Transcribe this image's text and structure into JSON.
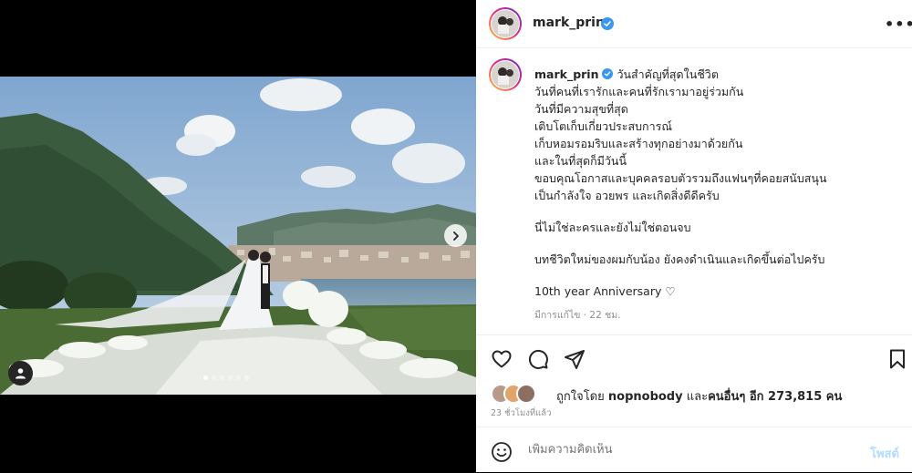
{
  "post": {
    "username": "mark_prin",
    "caption_lines": [
      "วันสำคัญที่สุดในชีวิต",
      "วันที่คนที่เรารักและคนที่รักเรามาอยู่ร่วมกัน",
      "วันที่มีความสุขที่สุด",
      "เติบโตเก็บเกี่ยวประสบการณ์",
      "เก็บหอมรอมริบและสร้างทุกอย่างมาด้วยกัน",
      "และในที่สุดก็มีวันนี้",
      "ขอบคุณโอกาสและบุคคลรอบตัวรวมถึงแฟนๆที่คอยสนับสนุน",
      "เป็นกำลังใจ อวยพร และเกิดสิ่งดีดีครับ"
    ],
    "caption_line_2": "นี่ไม่ใช่ละครและยังไม่ใช่ตอนจบ",
    "caption_line_3": "บทชีวิตใหม่ของผมกับน้อง ยังคงดำเนินและเกิดขึ้นต่อไปครับ",
    "caption_line_4": "10th year Anniversary ♡",
    "edited_label": "มีการแก้ไข · 22 ชม.",
    "likes_prefix": "ถูกใจโดย ",
    "likes_user": "nopnobody",
    "likes_and": " และ",
    "likes_others": "คนอื่นๆ อีก 273,815 คน",
    "time_ago": "23 ชั่วโมงที่แล้ว",
    "comment_placeholder": "เพิ่มความคิดเห็น",
    "post_button": "โพสต์",
    "more_label": "•••",
    "carousel_total": 6,
    "carousel_current": 1
  },
  "colors": {
    "accent": "#0095f6",
    "verified": "#3897f0",
    "post_button_disabled": "#b3dbff"
  },
  "icons": [
    "verified-badge-icon",
    "more-options-icon",
    "heart-icon",
    "comment-icon",
    "share-icon",
    "bookmark-icon",
    "emoji-icon",
    "next-arrow-icon",
    "user-tag-icon"
  ]
}
